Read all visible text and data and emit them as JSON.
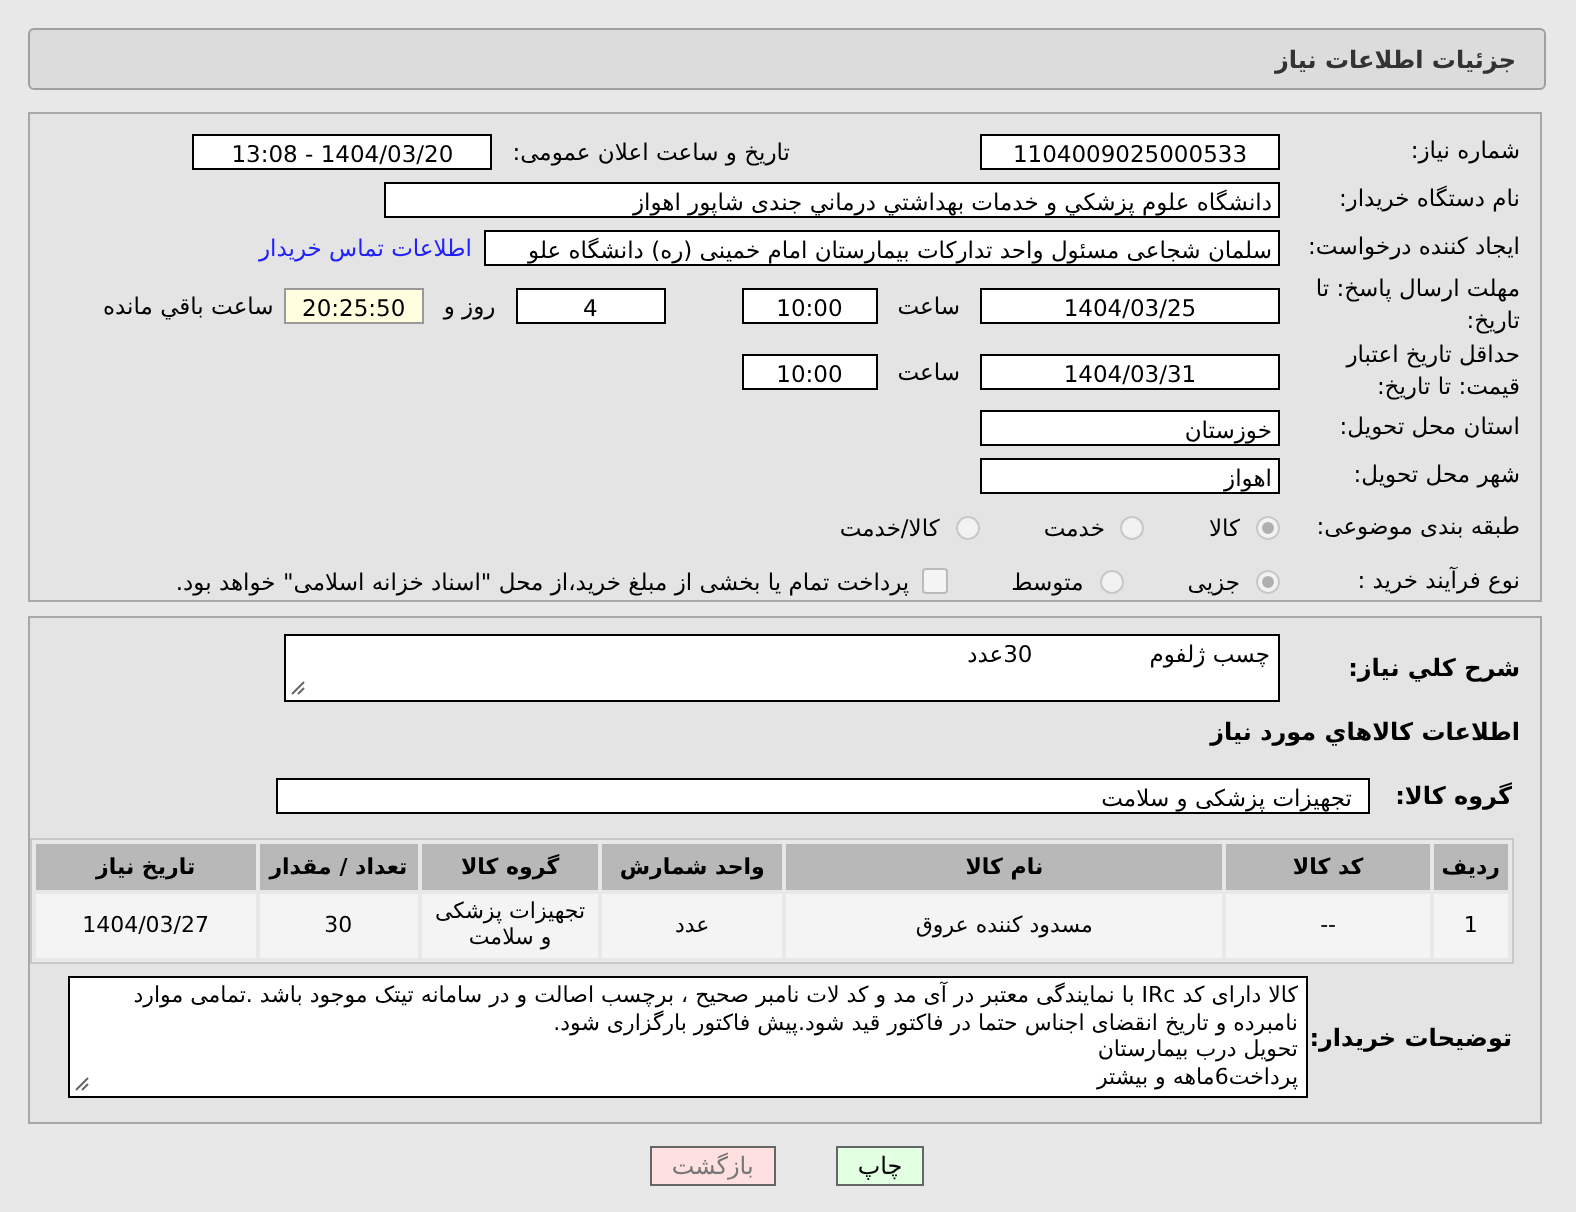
{
  "header": {
    "title": "جزئیات اطلاعات نیاز"
  },
  "form": {
    "need_number": {
      "label": "شماره نیاز:",
      "value": "1104009025000533"
    },
    "announce": {
      "label": "تاریخ و ساعت اعلان عمومی:",
      "value": "1404/03/20 - 13:08"
    },
    "buyer": {
      "label": "نام دستگاه خریدار:",
      "value": "دانشگاه علوم پزشكي و خدمات بهداشتي درماني جندی شاپور اهواز"
    },
    "creator": {
      "label": "ایجاد کننده درخواست:",
      "value": "سلمان شجاعی مسئول واحد تدارکات بیمارستان امام خمینی (ره) دانشگاه علو",
      "link": "اطلاعات تماس خریدار"
    },
    "deadline": {
      "label": "مهلت ارسال پاسخ: تا تاریخ:",
      "date": "1404/03/25",
      "time_label": "ساعت",
      "time": "10:00",
      "days": "4",
      "days_label": "روز و",
      "remaining": "20:25:50",
      "remaining_label": "ساعت باقي مانده"
    },
    "validity": {
      "label": "حداقل تاریخ اعتبار قیمت: تا تاریخ:",
      "date": "1404/03/31",
      "time_label": "ساعت",
      "time": "10:00"
    },
    "province": {
      "label": "استان محل تحویل:",
      "value": "خوزستان"
    },
    "city": {
      "label": "شهر محل تحویل:",
      "value": "اهواز"
    },
    "classification": {
      "label": "طبقه بندی موضوعی:",
      "options": [
        {
          "label": "کالا",
          "selected": true
        },
        {
          "label": "خدمت",
          "selected": false
        },
        {
          "label": "کالا/خدمت",
          "selected": false
        }
      ]
    },
    "purchase_type": {
      "label": "نوع فرآیند خرید :",
      "options": [
        {
          "label": "جزیی",
          "selected": true
        },
        {
          "label": "متوسط",
          "selected": false
        }
      ],
      "treasury": {
        "label": "پرداخت تمام یا بخشی از مبلغ خرید،از محل \"اسناد خزانه اسلامی\" خواهد بود.",
        "checked": false
      }
    }
  },
  "details": {
    "description": {
      "label": "شرح کلي نیاز:",
      "value": "چسب ژلفوم                30عدد"
    },
    "goods_heading": "اطلاعات کالاهاي مورد نیاز",
    "goods_group": {
      "label": "گروه کالا:",
      "value": "تجهیزات پزشکی و سلامت"
    },
    "table": {
      "columns": [
        "ردیف",
        "کد کالا",
        "نام کالا",
        "واحد شمارش",
        "گروه کالا",
        "تعداد / مقدار",
        "تاریخ نیاز"
      ],
      "rows": [
        [
          "1",
          "--",
          "مسدود کننده عروق",
          "عدد",
          "تجهیزات پزشکی و سلامت",
          "30",
          "1404/03/27"
        ]
      ]
    },
    "buyer_notes": {
      "label": "توضیحات خریدار:",
      "lines": [
        "کالا دارای کد IRc با نمایندگی معتبر در آی مد و کد لات نامبر صحیح ، برچسب اصالت و در سامانه تیتک موجود باشد .تمامی موارد نامبرده و تاریخ انقضای اجناس حتما در فاکتور قید شود.پیش فاکتور بارگزاری شود.",
        "تحویل درب بیمارستان",
        "پرداخت6ماهه و بیشتر"
      ]
    }
  },
  "buttons": [
    {
      "kind": "print",
      "label": "چاپ"
    },
    {
      "kind": "back",
      "label": "بازگشت"
    }
  ]
}
